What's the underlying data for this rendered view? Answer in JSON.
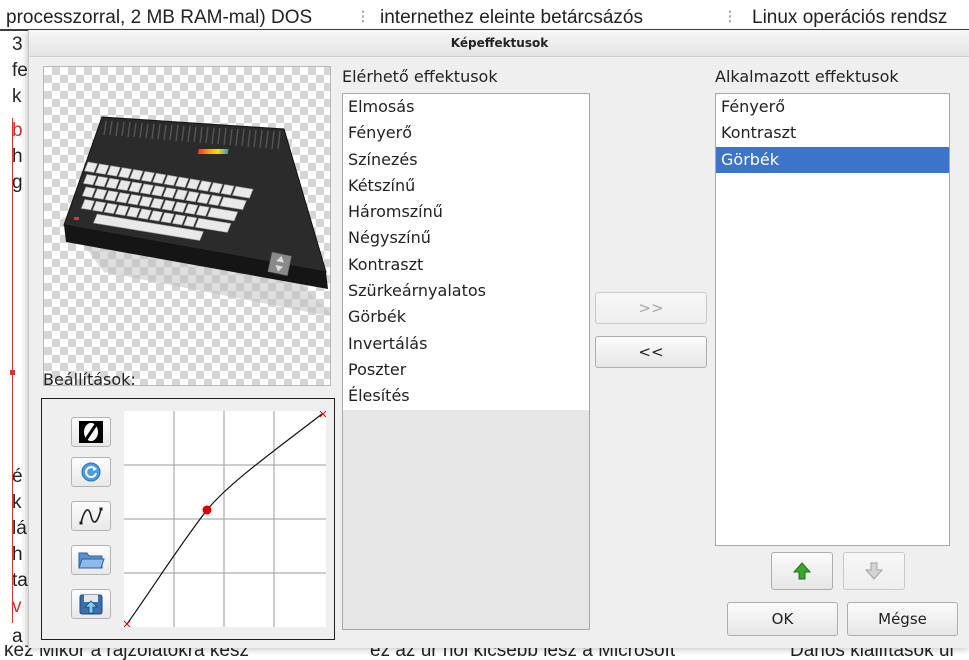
{
  "background_document": {
    "top_line": [
      "processzorral, 2 MB RAM-mal) DOS",
      "internethez eleinte betárcsázós",
      "Linux operációs rendsz"
    ],
    "left_fragments": [
      "3",
      "fe",
      "k",
      "b",
      "h",
      "g",
      "é",
      "k",
      "lá",
      "h",
      "ta",
      "v",
      "a"
    ],
    "bottom_line": [
      "kez Mikor a rajzolatokra kész",
      "ez az úr hol kicsébb lesz a Microsoft",
      "Dános kiállítások ül"
    ]
  },
  "dialog": {
    "title": "Képeffektusok",
    "available": {
      "label": "Elérhető effektusok",
      "items": [
        "Elmosás",
        "Fényerő",
        "Színezés",
        "Kétszínű",
        "Háromszínű",
        "Négyszínű",
        "Kontraszt",
        "Szürkeárnyalatos",
        "Görbék",
        "Invertálás",
        "Poszter",
        "Élesítés"
      ]
    },
    "applied": {
      "label": "Alkalmazott effektusok",
      "items": [
        "Fényerő",
        "Kontraszt",
        "Görbék"
      ],
      "selected_index": 2
    },
    "buttons": {
      "add": ">>",
      "remove": "<<",
      "ok": "OK",
      "cancel": "Mégse"
    },
    "settings": {
      "label": "Beállítások:"
    }
  },
  "colors": {
    "selection": "#3b74c8",
    "curve_point": "#e00000",
    "arrow_green": "#3aa62d"
  },
  "icons": [
    "invert-icon",
    "reset-icon",
    "smooth-curve-icon",
    "open-folder-icon",
    "save-icon",
    "move-up-icon",
    "move-down-icon"
  ]
}
